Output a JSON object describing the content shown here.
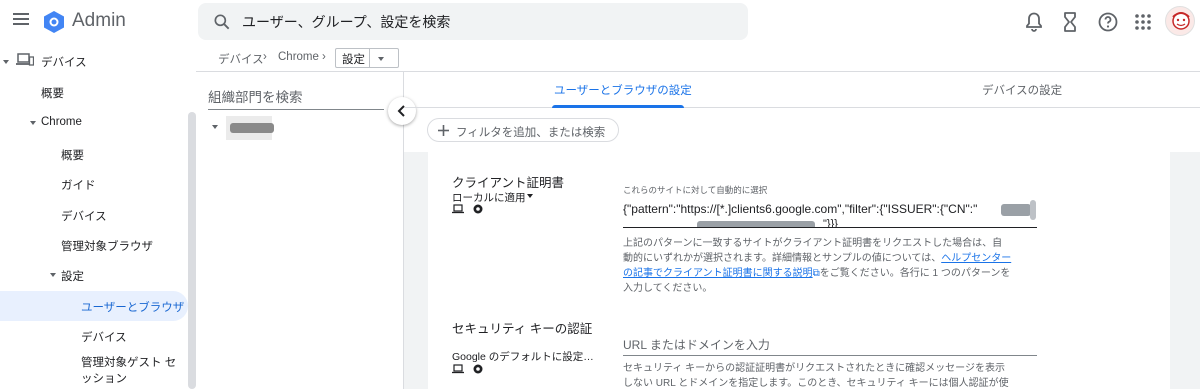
{
  "app": {
    "title": "Admin"
  },
  "search": {
    "placeholder": "ユーザー、グループ、設定を検索"
  },
  "header_icons": [
    "bell-icon",
    "hourglass-icon",
    "help-icon",
    "apps-grid-icon"
  ],
  "sidebar": {
    "items": [
      {
        "label": "デバイス",
        "icon": "devices-icon"
      },
      {
        "label": "概要"
      },
      {
        "label": "Chrome"
      },
      {
        "label": "概要"
      },
      {
        "label": "ガイド"
      },
      {
        "label": "デバイス"
      },
      {
        "label": "管理対象ブラウザ"
      },
      {
        "label": "設定"
      },
      {
        "label": "ユーザーとブラウザ",
        "active": true
      },
      {
        "label": "デバイス"
      },
      {
        "label": "管理対象ゲスト セッション"
      }
    ]
  },
  "breadcrumb": {
    "items": [
      "デバイス",
      "Chrome"
    ],
    "current": "設定"
  },
  "org_panel": {
    "search_placeholder": "組織部門を検索"
  },
  "tabs": [
    {
      "label": "ユーザーとブラウザの設定",
      "active": true
    },
    {
      "label": "デバイスの設定",
      "active": false
    }
  ],
  "filter": {
    "label": "フィルタを追加、または検索"
  },
  "colors": {
    "accent": "#1a73e8",
    "active_nav_bg": "#e8f0fe"
  },
  "settings": {
    "client_cert": {
      "title": "クライアント証明書",
      "scope": "ローカルに適用",
      "field_label": "これらのサイトに対して自動的に選択",
      "value": "{\"pattern\":\"https://[*.]clients6.google.com\",\"filter\":{\"ISSUER\":{\"CN\":\"",
      "value_line2": "\"}}}",
      "help_line1": "上記のパターンに一致するサイトがクライアント証明書をリクエストした場合は、自",
      "help_line2_prefix": "動的にいずれかが選択されます。詳細情報とサンプルの値については、",
      "help_link": "ヘルプセンターの記事でクライアント証明書に関する説明",
      "help_suffix": "をご覧ください。各行に 1 つのパターンを入力してください。"
    },
    "security_key": {
      "title": "セキュリティ キーの認証",
      "scope": "Google のデフォルトに設定し...",
      "placeholder": "URL またはドメインを入力",
      "help_line1": "セキュリティ キーからの認証証明書がリクエストされたときに確認メッセージを表示",
      "help_line2": "しない URL とドメインを指定します。このとき、セキュリティ キーには個人認証が使"
    }
  }
}
